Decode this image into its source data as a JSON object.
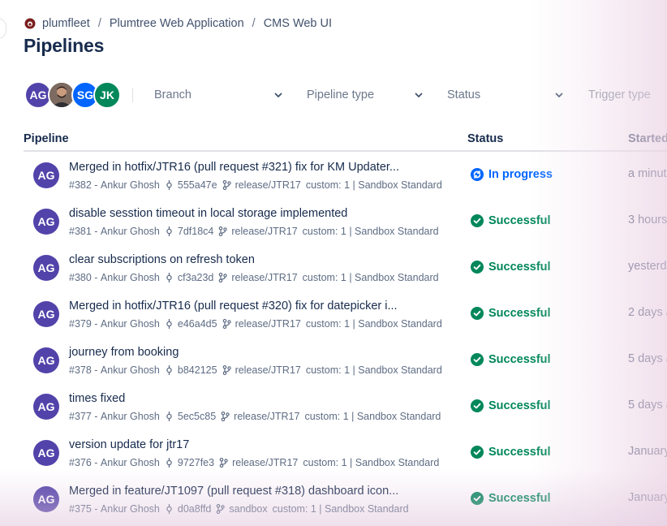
{
  "breadcrumb": {
    "logo_icon": "plumfleet-logo-icon",
    "items": [
      "plumfleet",
      "Plumtree Web Application",
      "CMS Web UI"
    ],
    "separator": "/"
  },
  "page_title": "Pipelines",
  "filters": {
    "avatars": [
      {
        "initials": "AG",
        "color": "#5243aa"
      },
      {
        "initials": "",
        "color": "#4a3b35",
        "type": "photo"
      },
      {
        "initials": "SG",
        "color": "#0065ff"
      },
      {
        "initials": "JK",
        "color": "#00875a"
      }
    ],
    "branch": "Branch",
    "pipeline_type": "Pipeline type",
    "status": "Status",
    "trigger_type": "Trigger type"
  },
  "table": {
    "headers": {
      "pipeline": "Pipeline",
      "status": "Status",
      "started": "Started"
    },
    "rows": [
      {
        "avatar": "AG",
        "title": "Merged in hotfix/JTR16 (pull request #321) fix for KM Updater...",
        "number": "#382",
        "author": "Ankur Ghosh",
        "commit": "555a47e",
        "branch": "release/JTR17",
        "custom": "custom: 1 | Sandbox Standard",
        "status": "In progress",
        "status_kind": "progress",
        "started": "a minut"
      },
      {
        "avatar": "AG",
        "title": "disable sesstion timeout in local storage implemented",
        "number": "#381",
        "author": "Ankur Ghosh",
        "commit": "7df18c4",
        "branch": "release/JTR17",
        "custom": "custom: 1 | Sandbox Standard",
        "status": "Successful",
        "status_kind": "success",
        "started": "3 hours"
      },
      {
        "avatar": "AG",
        "title": "clear subscriptions on refresh token",
        "number": "#380",
        "author": "Ankur Ghosh",
        "commit": "cf3a23d",
        "branch": "release/JTR17",
        "custom": "custom: 1 | Sandbox Standard",
        "status": "Successful",
        "status_kind": "success",
        "started": "yesterd"
      },
      {
        "avatar": "AG",
        "title": "Merged in hotfix/JTR16 (pull request #320) fix for datepicker i...",
        "number": "#379",
        "author": "Ankur Ghosh",
        "commit": "e46a4d5",
        "branch": "release/JTR17",
        "custom": "custom: 1 | Sandbox Standard",
        "status": "Successful",
        "status_kind": "success",
        "started": "2 days a"
      },
      {
        "avatar": "AG",
        "title": "journey from booking",
        "number": "#378",
        "author": "Ankur Ghosh",
        "commit": "b842125",
        "branch": "release/JTR17",
        "custom": "custom: 1 | Sandbox Standard",
        "status": "Successful",
        "status_kind": "success",
        "started": "5 days a"
      },
      {
        "avatar": "AG",
        "title": "times fixed",
        "number": "#377",
        "author": "Ankur Ghosh",
        "commit": "5ec5c85",
        "branch": "release/JTR17",
        "custom": "custom: 1 | Sandbox Standard",
        "status": "Successful",
        "status_kind": "success",
        "started": "5 days a"
      },
      {
        "avatar": "AG",
        "title": "version update for jtr17",
        "number": "#376",
        "author": "Ankur Ghosh",
        "commit": "9727fe3",
        "branch": "release/JTR17",
        "custom": "custom: 1 | Sandbox Standard",
        "status": "Successful",
        "status_kind": "success",
        "started": "January"
      },
      {
        "avatar": "AG",
        "title": "Merged in feature/JT1097 (pull request #318) dashboard icon...",
        "number": "#375",
        "author": "Ankur Ghosh",
        "commit": "d0a8ffd",
        "branch": "sandbox",
        "custom": "custom: 1 | Sandbox Standard",
        "status": "Successful",
        "status_kind": "success",
        "started": "January"
      }
    ]
  },
  "colors": {
    "success": "#00875a",
    "progress": "#0065ff",
    "avatar": "#5243aa"
  }
}
